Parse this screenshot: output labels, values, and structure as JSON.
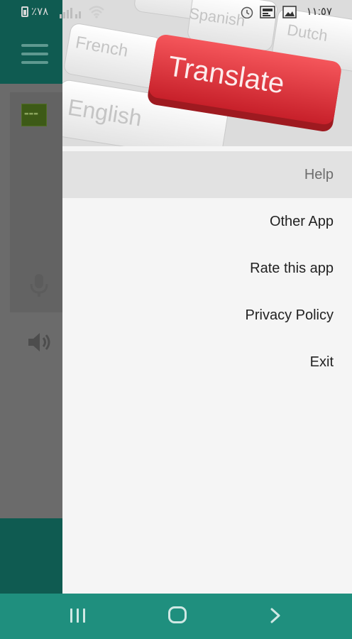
{
  "status_bar": {
    "battery_text": "٪٧٨",
    "time": "١١:٥٧",
    "icons": [
      "battery-icon",
      "signal-icon",
      "wifi-icon",
      "alarm-icon",
      "news-app-icon",
      "gallery-icon"
    ]
  },
  "background_app": {
    "icons": [
      "menu-icon",
      "flag-icon",
      "microphone-icon",
      "speaker-icon"
    ]
  },
  "drawer": {
    "header_keys": {
      "translate": "Translate",
      "french": "French",
      "english": "English",
      "spanish": "Spanish",
      "dutch": "Dutch"
    },
    "menu": [
      {
        "label": "Help",
        "selected": true
      },
      {
        "label": "Other App",
        "selected": false
      },
      {
        "label": "Rate this app",
        "selected": false
      },
      {
        "label": "Privacy Policy",
        "selected": false
      },
      {
        "label": "Exit",
        "selected": false
      }
    ]
  },
  "nav_bar": {
    "icons": [
      "recents-icon",
      "home-icon",
      "back-icon"
    ]
  },
  "colors": {
    "app_bar": "#0f5b51",
    "nav_bar": "#1f8f7e",
    "translate_key": "#e8323a",
    "drawer_bg": "#f5f5f5",
    "selected_item": "#e2e2e2"
  }
}
